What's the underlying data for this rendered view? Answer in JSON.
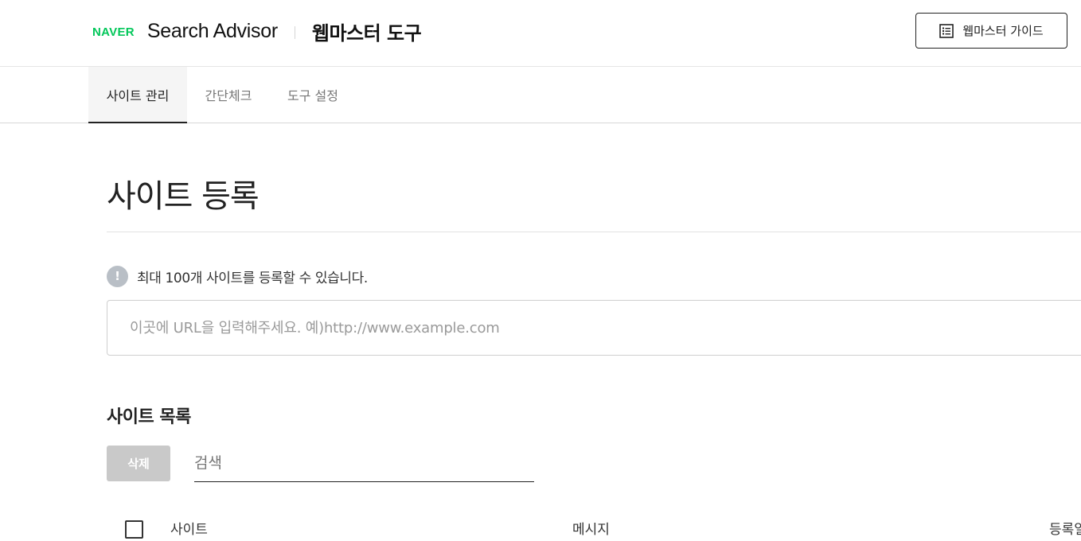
{
  "header": {
    "logo_text": "NAVER",
    "product_name": "Search Advisor",
    "tool_title": "웹마스터 도구",
    "guide_button_label": "웹마스터 가이드",
    "guide_icon": "list-icon"
  },
  "tabs": [
    {
      "label": "사이트 관리",
      "active": true
    },
    {
      "label": "간단체크",
      "active": false
    },
    {
      "label": "도구 설정",
      "active": false
    }
  ],
  "main": {
    "page_title": "사이트 등록",
    "notice_icon": "!",
    "notice_text": "최대 100개 사이트를 등록할 수 있습니다.",
    "url_input": {
      "value": "",
      "placeholder": "이곳에 URL을 입력해주세요. 예)http://www.example.com"
    },
    "list_title": "사이트 목록",
    "delete_label": "삭제",
    "search_input": {
      "value": "",
      "placeholder": "검색"
    },
    "table_headers": [
      "사이트",
      "메시지",
      "등록일"
    ]
  },
  "colors": {
    "brand_green": "#03c75a",
    "disabled_button": "#c9c9c9",
    "active_tab_background": "#f5f5f5"
  }
}
